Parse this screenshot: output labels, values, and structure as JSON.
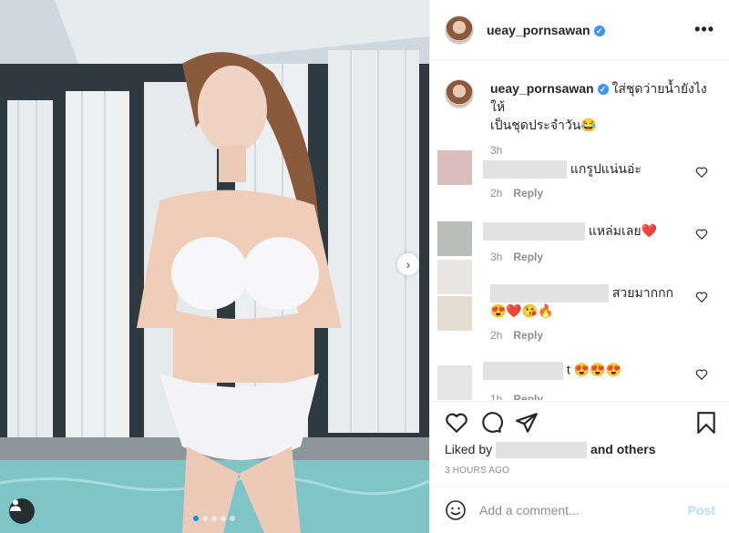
{
  "post": {
    "username": "ueay_pornsawan",
    "verified_icon": "verified-badge-icon",
    "more_label": "•••"
  },
  "caption": {
    "username": "ueay_pornsawan",
    "text_line1": "ใส่ชุดว่ายน้ำยังไงให้",
    "text_line2": "เป็นชุดประจำวัน😂",
    "time": "3h"
  },
  "comments": [
    {
      "text": "แกรูปแน่นอ่ะ",
      "time": "2h",
      "reply": "Reply"
    },
    {
      "text": "แหล่มเลย❤️",
      "time": "3h",
      "reply": "Reply"
    },
    {
      "text_line1": "สวยมากกก",
      "text_line2": "😍❤️😘🔥",
      "time": "2h",
      "reply": "Reply"
    },
    {
      "text": "t 😍😍😍",
      "time": "1h",
      "reply": "Reply"
    }
  ],
  "likes": {
    "prefix": "Liked by",
    "suffix": "and others"
  },
  "posted_time": "3 HOURS AGO",
  "add_comment": {
    "placeholder": "Add a comment...",
    "post_label": "Post"
  },
  "carousel": {
    "total": 5,
    "current": 1
  },
  "colors": {
    "accent": "#0095f6",
    "verified": "#3897f0",
    "post_disabled": "#b2dffc",
    "heart_red": "#ed4956"
  }
}
